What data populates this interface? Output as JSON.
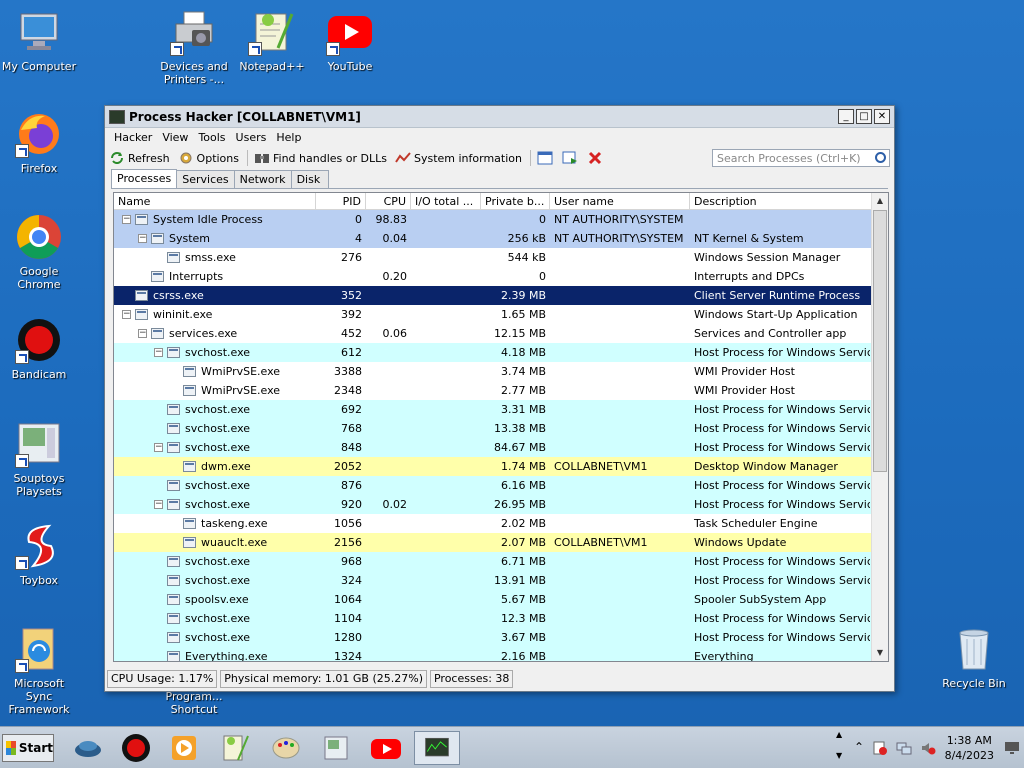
{
  "desktop_icons": [
    {
      "label": "My Computer"
    },
    {
      "label": "Devices and Printers -..."
    },
    {
      "label": "Notepad++"
    },
    {
      "label": "YouTube"
    },
    {
      "label": "Firefox"
    },
    {
      "label": "Google Chrome"
    },
    {
      "label": "Bandicam"
    },
    {
      "label": "Souptoys Playsets"
    },
    {
      "label": "Toybox"
    },
    {
      "label": "Microsoft Sync Framework"
    },
    {
      "label": "Recycle Bin"
    },
    {
      "label": "Program... Shortcut"
    }
  ],
  "window": {
    "title": "Process Hacker [COLLABNET\\VM1]",
    "menu": [
      "Hacker",
      "View",
      "Tools",
      "Users",
      "Help"
    ],
    "toolbar": {
      "refresh": "Refresh",
      "options": "Options",
      "find_handles": "Find handles or DLLs",
      "system_info": "System information"
    },
    "search_placeholder": "Search Processes (Ctrl+K)",
    "tabs": [
      "Processes",
      "Services",
      "Network",
      "Disk"
    ],
    "columns": [
      "Name",
      "PID",
      "CPU",
      "I/O total ...",
      "Private b...",
      "User name",
      "Description"
    ],
    "rows": [
      {
        "name": "System Idle Process",
        "depth": 0,
        "toggle": "−",
        "pid": "0",
        "cpu": "98.83",
        "priv": "0",
        "user": "NT AUTHORITY\\SYSTEM",
        "desc": "",
        "color": "#b9cff2"
      },
      {
        "name": "System",
        "depth": 1,
        "toggle": "−",
        "pid": "4",
        "cpu": "0.04",
        "priv": "256 kB",
        "user": "NT AUTHORITY\\SYSTEM",
        "desc": "NT Kernel & System",
        "color": "#b9cff2"
      },
      {
        "name": "smss.exe",
        "depth": 2,
        "toggle": "",
        "pid": "276",
        "cpu": "",
        "priv": "544 kB",
        "user": "",
        "desc": "Windows Session Manager",
        "color": "#ffffff"
      },
      {
        "name": "Interrupts",
        "depth": 1,
        "toggle": "",
        "pid": "",
        "cpu": "0.20",
        "priv": "0",
        "user": "",
        "desc": "Interrupts and DPCs",
        "color": "#ffffff"
      },
      {
        "name": "csrss.exe",
        "depth": 0,
        "toggle": "",
        "pid": "352",
        "cpu": "",
        "priv": "2.39 MB",
        "user": "",
        "desc": "Client Server Runtime Process",
        "color": "#0a246a",
        "selected": true
      },
      {
        "name": "wininit.exe",
        "depth": 0,
        "toggle": "−",
        "pid": "392",
        "cpu": "",
        "priv": "1.65 MB",
        "user": "",
        "desc": "Windows Start-Up Application",
        "color": "#ffffff"
      },
      {
        "name": "services.exe",
        "depth": 1,
        "toggle": "−",
        "pid": "452",
        "cpu": "0.06",
        "priv": "12.15 MB",
        "user": "",
        "desc": "Services and Controller app",
        "color": "#ffffff"
      },
      {
        "name": "svchost.exe",
        "depth": 2,
        "toggle": "−",
        "pid": "612",
        "cpu": "",
        "priv": "4.18 MB",
        "user": "",
        "desc": "Host Process for Windows Services",
        "color": "#d0ffff"
      },
      {
        "name": "WmiPrvSE.exe",
        "depth": 3,
        "toggle": "",
        "pid": "3388",
        "cpu": "",
        "priv": "3.74 MB",
        "user": "",
        "desc": "WMI Provider Host",
        "color": "#ffffff"
      },
      {
        "name": "WmiPrvSE.exe",
        "depth": 3,
        "toggle": "",
        "pid": "2348",
        "cpu": "",
        "priv": "2.77 MB",
        "user": "",
        "desc": "WMI Provider Host",
        "color": "#ffffff"
      },
      {
        "name": "svchost.exe",
        "depth": 2,
        "toggle": "",
        "pid": "692",
        "cpu": "",
        "priv": "3.31 MB",
        "user": "",
        "desc": "Host Process for Windows Services",
        "color": "#d0ffff"
      },
      {
        "name": "svchost.exe",
        "depth": 2,
        "toggle": "",
        "pid": "768",
        "cpu": "",
        "priv": "13.38 MB",
        "user": "",
        "desc": "Host Process for Windows Services",
        "color": "#d0ffff"
      },
      {
        "name": "svchost.exe",
        "depth": 2,
        "toggle": "−",
        "pid": "848",
        "cpu": "",
        "priv": "84.67 MB",
        "user": "",
        "desc": "Host Process for Windows Services",
        "color": "#d0ffff"
      },
      {
        "name": "dwm.exe",
        "depth": 3,
        "toggle": "",
        "pid": "2052",
        "cpu": "",
        "priv": "1.74 MB",
        "user": "COLLABNET\\VM1",
        "desc": "Desktop Window Manager",
        "color": "#ffffaa"
      },
      {
        "name": "svchost.exe",
        "depth": 2,
        "toggle": "",
        "pid": "876",
        "cpu": "",
        "priv": "6.16 MB",
        "user": "",
        "desc": "Host Process for Windows Services",
        "color": "#d0ffff"
      },
      {
        "name": "svchost.exe",
        "depth": 2,
        "toggle": "−",
        "pid": "920",
        "cpu": "0.02",
        "priv": "26.95 MB",
        "user": "",
        "desc": "Host Process for Windows Services",
        "color": "#d0ffff"
      },
      {
        "name": "taskeng.exe",
        "depth": 3,
        "toggle": "",
        "pid": "1056",
        "cpu": "",
        "priv": "2.02 MB",
        "user": "",
        "desc": "Task Scheduler Engine",
        "color": "#ffffff"
      },
      {
        "name": "wuauclt.exe",
        "depth": 3,
        "toggle": "",
        "pid": "2156",
        "cpu": "",
        "priv": "2.07 MB",
        "user": "COLLABNET\\VM1",
        "desc": "Windows Update",
        "color": "#ffffaa"
      },
      {
        "name": "svchost.exe",
        "depth": 2,
        "toggle": "",
        "pid": "968",
        "cpu": "",
        "priv": "6.71 MB",
        "user": "",
        "desc": "Host Process for Windows Services",
        "color": "#d0ffff"
      },
      {
        "name": "svchost.exe",
        "depth": 2,
        "toggle": "",
        "pid": "324",
        "cpu": "",
        "priv": "13.91 MB",
        "user": "",
        "desc": "Host Process for Windows Services",
        "color": "#d0ffff"
      },
      {
        "name": "spoolsv.exe",
        "depth": 2,
        "toggle": "",
        "pid": "1064",
        "cpu": "",
        "priv": "5.67 MB",
        "user": "",
        "desc": "Spooler SubSystem App",
        "color": "#d0ffff"
      },
      {
        "name": "svchost.exe",
        "depth": 2,
        "toggle": "",
        "pid": "1104",
        "cpu": "",
        "priv": "12.3 MB",
        "user": "",
        "desc": "Host Process for Windows Services",
        "color": "#d0ffff"
      },
      {
        "name": "svchost.exe",
        "depth": 2,
        "toggle": "",
        "pid": "1280",
        "cpu": "",
        "priv": "3.67 MB",
        "user": "",
        "desc": "Host Process for Windows Services",
        "color": "#d0ffff"
      },
      {
        "name": "Everything.exe",
        "depth": 2,
        "toggle": "",
        "pid": "1324",
        "cpu": "",
        "priv": "2.16 MB",
        "user": "",
        "desc": "Everything",
        "color": "#d0ffff"
      }
    ],
    "status": {
      "cpu": "CPU Usage: 1.17%",
      "memory": "Physical memory: 1.01 GB (25.27%)",
      "processes": "Processes: 38"
    }
  },
  "taskbar": {
    "start_label": "Start",
    "time": "1:38 AM",
    "date": "8/4/2023"
  },
  "colors": {
    "desktop": "#1d6fc3",
    "selected_row": "#0a246a",
    "system_row": "#b9cff2",
    "service_row": "#d0ffff",
    "user_row": "#ffffaa"
  }
}
